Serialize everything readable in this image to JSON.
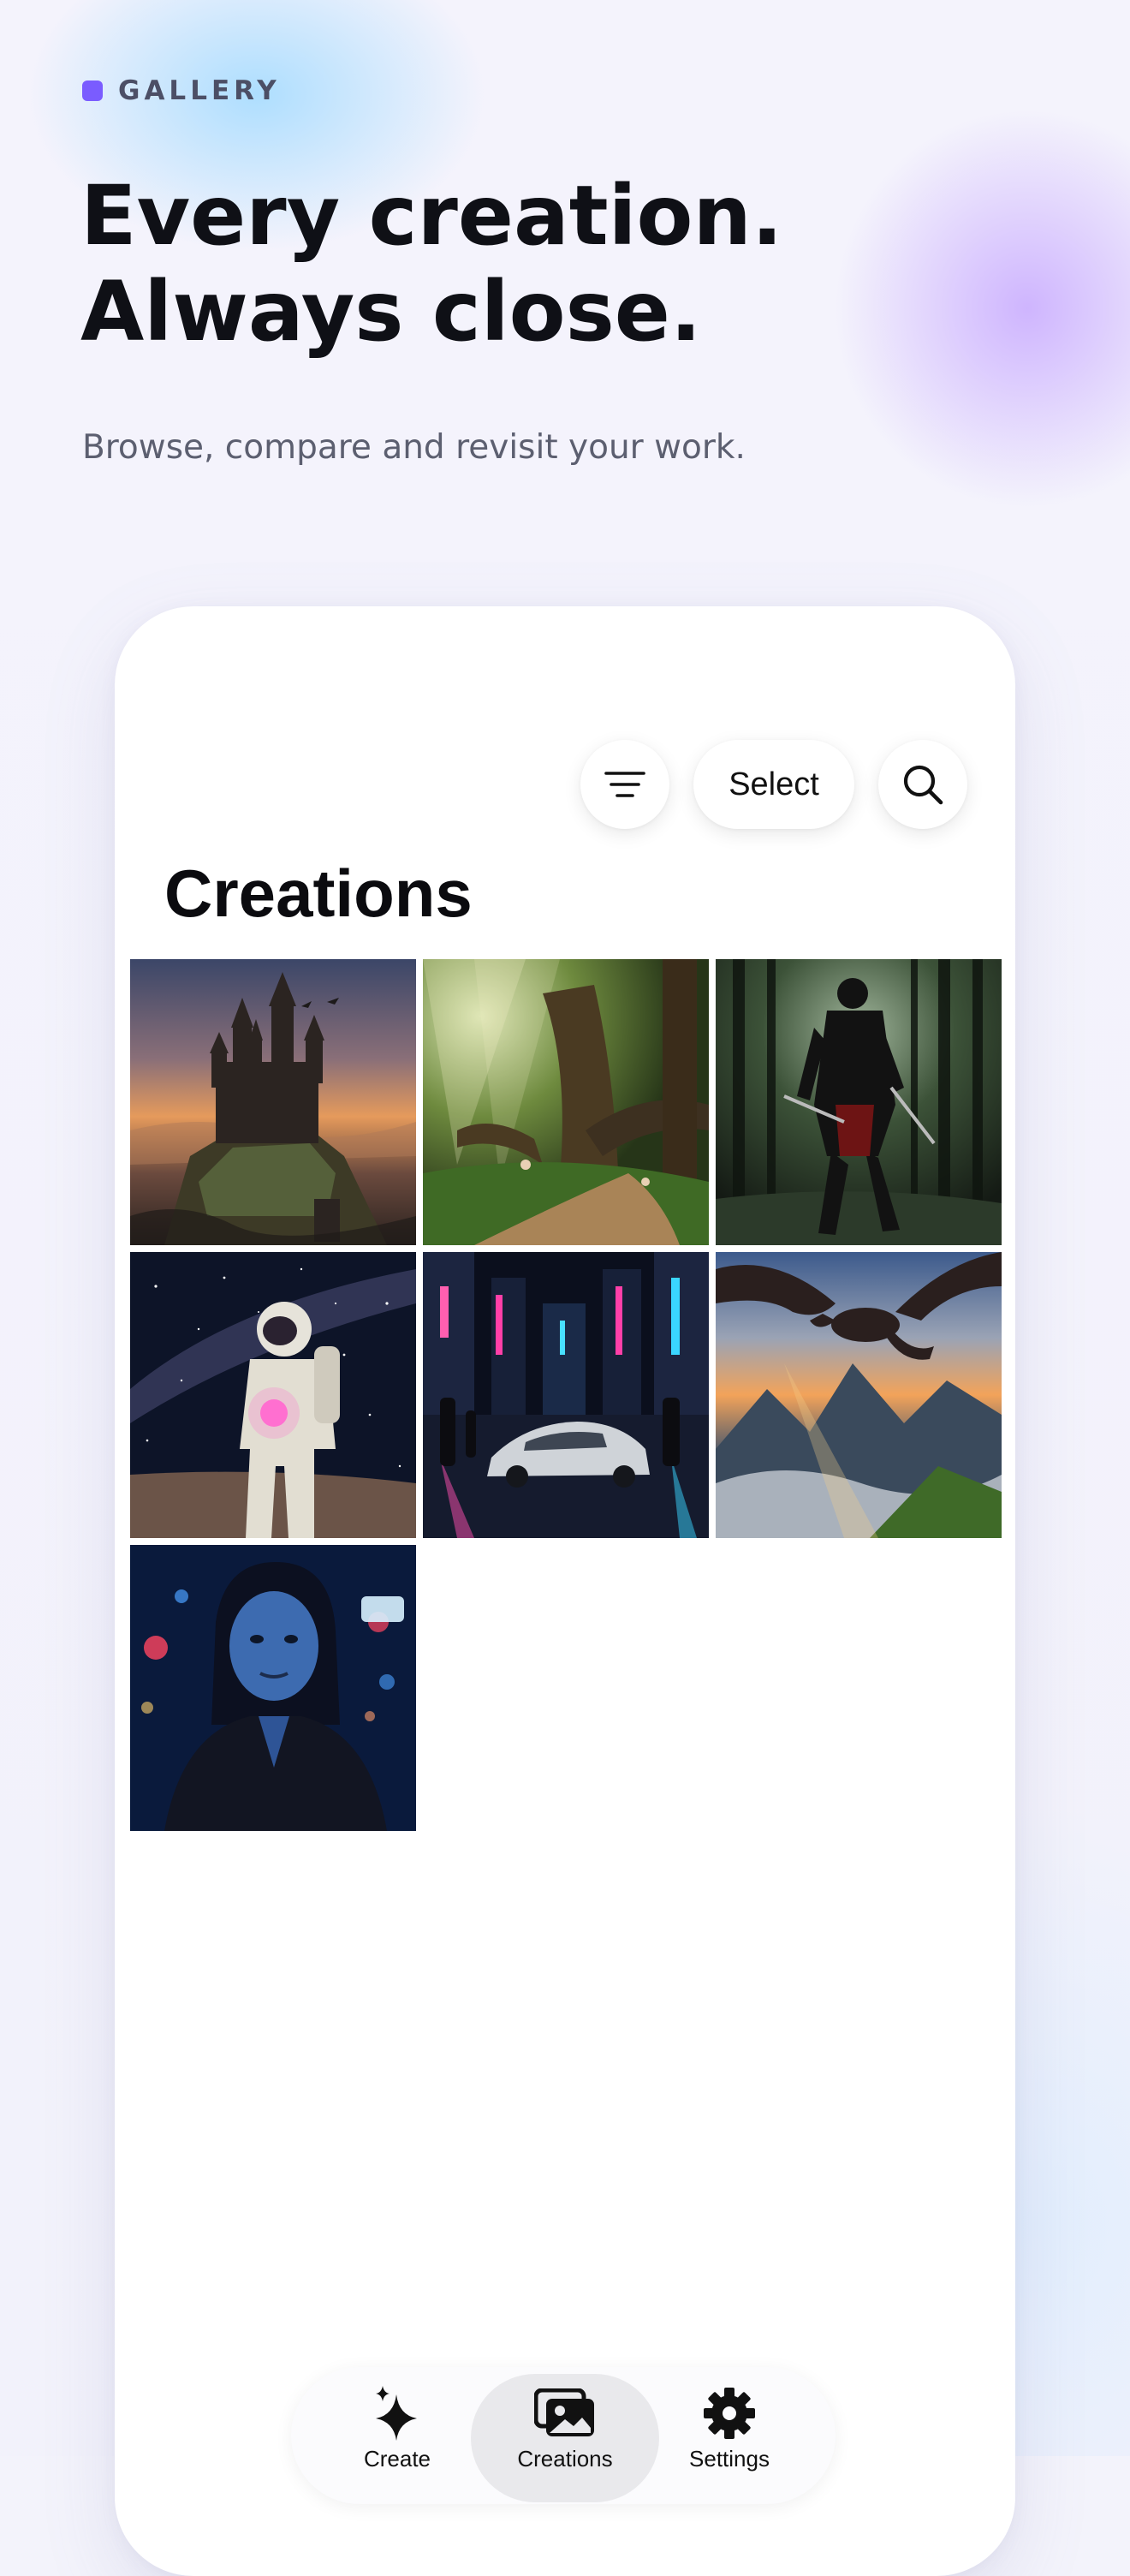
{
  "header": {
    "eyebrow": "GALLERY",
    "headline_line1": "Every creation.",
    "headline_line2": "Always close.",
    "subhead": "Browse, compare and revisit your work."
  },
  "toolbar": {
    "filter_icon": "filter-lines-icon",
    "select_label": "Select",
    "search_icon": "magnifier-icon"
  },
  "page": {
    "title": "Creations"
  },
  "gallery": {
    "items": [
      {
        "subject": "castle-on-cliff"
      },
      {
        "subject": "enchanted-forest-path"
      },
      {
        "subject": "samurai-in-bamboo-forest"
      },
      {
        "subject": "astronaut-holding-glowing-orb"
      },
      {
        "subject": "sports-car-neon-city"
      },
      {
        "subject": "dragon-over-mountains"
      },
      {
        "subject": "woman-neon-city-portrait"
      }
    ]
  },
  "tabbar": {
    "tabs": [
      {
        "label": "Create",
        "icon": "sparkle-icon",
        "active": false
      },
      {
        "label": "Creations",
        "icon": "photos-icon",
        "active": true
      },
      {
        "label": "Settings",
        "icon": "gear-icon",
        "active": false
      }
    ]
  },
  "colors": {
    "accent": "#7a5cff",
    "headline": "#0f1016",
    "subhead": "#5c5f70",
    "card": "#ffffff",
    "active_tab": "#e9e9ec"
  }
}
